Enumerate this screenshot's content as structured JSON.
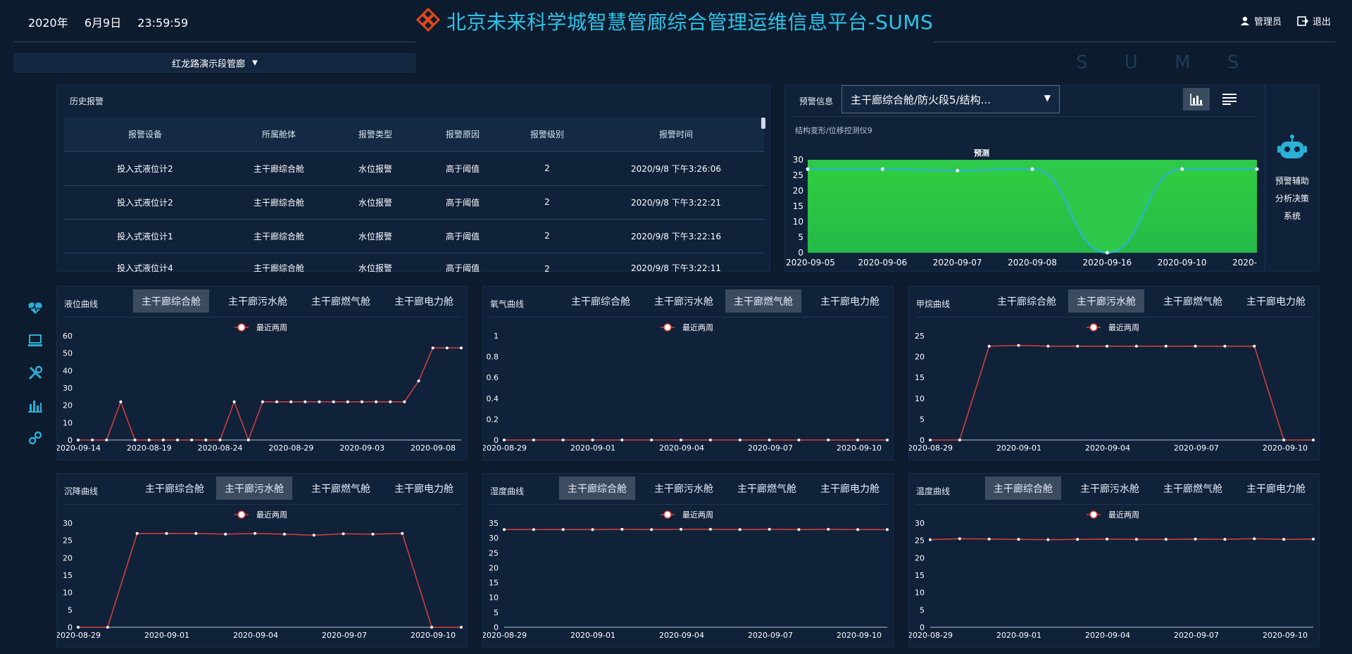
{
  "header": {
    "date_year": "2020年",
    "date_md": "6月9日",
    "time": "23:59:59",
    "title": "北京未来科学城智慧管廊综合管理运维信息平台-SUMS",
    "watermark": "SUMS",
    "user": "管理员",
    "logout": "退出",
    "accent_color": "#2dc3e8",
    "logo_color": "#e2471d"
  },
  "site_select": {
    "value": "红龙路演示段管廊"
  },
  "nav_icons": [
    "heartbeat-icon",
    "monitor-icon",
    "tools-icon",
    "bar-chart-icon",
    "gear-link-icon"
  ],
  "alarm": {
    "title": "历史报警",
    "columns": [
      "报警设备",
      "所属舱体",
      "报警类型",
      "报警原因",
      "报警级别",
      "报警时间"
    ],
    "rows": [
      [
        "投入式液位计2",
        "主干廊综合舱",
        "水位报警",
        "高于阈值",
        "2",
        "2020/9/8 下午3:26:06"
      ],
      [
        "投入式液位计2",
        "主干廊综合舱",
        "水位报警",
        "高于阈值",
        "2",
        "2020/9/8 下午3:22:21"
      ],
      [
        "投入式液位计1",
        "主干廊综合舱",
        "水位报警",
        "高于阈值",
        "2",
        "2020/9/8 下午3:22:16"
      ],
      [
        "投入式液位计4",
        "主干廊综合舱",
        "水位报警",
        "高于阈值",
        "2",
        "2020/9/8 下午3:22:11"
      ]
    ]
  },
  "warning": {
    "label": "预警信息",
    "select_value": "主干廊综合舱/防火段5/结构...",
    "ai_label_lines": [
      "预警辅助",
      "分析决策",
      "系统"
    ]
  },
  "tabs": [
    "主干廊综合舱",
    "主干廊污水舱",
    "主干廊燃气舱",
    "主干廊电力舱"
  ],
  "legend_label": "最近两周",
  "chart_data": [
    {
      "id": "warn",
      "type": "area",
      "title": "预测",
      "subtitle": "结构变形/位移控测仪9",
      "x": [
        "2020-09-05",
        "2020-09-06",
        "2020-09-07",
        "2020-09-08",
        "2020-09-16",
        "2020-09-10",
        "2020-"
      ],
      "values": [
        27,
        27,
        26.5,
        27,
        0,
        27,
        27
      ],
      "ylim": [
        0,
        30
      ],
      "yticks": [
        0,
        5,
        10,
        15,
        20,
        25,
        30
      ],
      "fill_color": "#2ec94a",
      "line_color": "#2bb5c9"
    },
    {
      "id": "level",
      "type": "line",
      "title": "液位曲线",
      "active_tab": 0,
      "series": [
        {
          "name": "最近两周",
          "values": [
            0,
            0,
            0,
            22,
            0,
            0,
            0,
            0,
            0,
            0,
            0,
            22,
            0,
            22,
            22,
            22,
            22,
            22,
            22,
            22,
            22,
            22,
            22,
            22,
            34,
            53,
            53,
            53
          ]
        }
      ],
      "x_labels": [
        "2020-09-14",
        "2020-08-19",
        "2020-08-24",
        "2020-08-29",
        "2020-09-03",
        "2020-09-08"
      ],
      "ylim": [
        0,
        60
      ],
      "yticks": [
        0,
        10,
        20,
        30,
        40,
        50,
        60
      ]
    },
    {
      "id": "oxygen",
      "type": "line",
      "title": "氧气曲线",
      "active_tab": 2,
      "series": [
        {
          "name": "最近两周",
          "values": [
            0,
            0,
            0,
            0,
            0,
            0,
            0,
            0,
            0,
            0,
            0,
            0,
            0,
            0
          ]
        }
      ],
      "x_labels": [
        "2020-08-29",
        "2020-09-01",
        "2020-09-04",
        "2020-09-07",
        "2020-09-10"
      ],
      "ylim": [
        0,
        1
      ],
      "yticks": [
        0,
        0.2,
        0.4,
        0.6,
        0.8,
        1
      ]
    },
    {
      "id": "methane",
      "type": "line",
      "title": "甲烷曲线",
      "active_tab": 1,
      "series": [
        {
          "name": "最近两周",
          "values": [
            0,
            0,
            22.5,
            22.7,
            22.5,
            22.5,
            22.5,
            22.5,
            22.5,
            22.5,
            22.5,
            22.5,
            0,
            0
          ]
        }
      ],
      "x_labels": [
        "2020-08-29",
        "2020-09-01",
        "2020-09-04",
        "2020-09-07",
        "2020-09-10"
      ],
      "ylim": [
        0,
        25
      ],
      "yticks": [
        0,
        5,
        10,
        15,
        20,
        25
      ]
    },
    {
      "id": "settle",
      "type": "line",
      "title": "沉降曲线",
      "active_tab": 1,
      "series": [
        {
          "name": "最近两周",
          "values": [
            0,
            0,
            27,
            27,
            27,
            26.8,
            27,
            26.8,
            26.5,
            26.9,
            26.8,
            27,
            0,
            0
          ]
        }
      ],
      "x_labels": [
        "2020-08-29",
        "2020-09-01",
        "2020-09-04",
        "2020-09-07",
        "2020-09-10"
      ],
      "ylim": [
        0,
        30
      ],
      "yticks": [
        0,
        5,
        10,
        15,
        20,
        25,
        30
      ]
    },
    {
      "id": "humidity",
      "type": "line",
      "title": "湿度曲线",
      "active_tab": 0,
      "series": [
        {
          "name": "最近两周",
          "values": [
            32.8,
            32.8,
            32.8,
            32.8,
            32.9,
            32.8,
            32.9,
            32.9,
            32.8,
            32.9,
            32.8,
            32.9,
            32.8,
            32.8
          ]
        }
      ],
      "x_labels": [
        "2020-08-29",
        "2020-09-01",
        "2020-09-04",
        "2020-09-07",
        "2020-09-10"
      ],
      "ylim": [
        0,
        35
      ],
      "yticks": [
        0,
        5,
        10,
        15,
        20,
        25,
        30,
        35
      ]
    },
    {
      "id": "temp",
      "type": "line",
      "title": "温度曲线",
      "active_tab": 0,
      "series": [
        {
          "name": "最近两周",
          "values": [
            25.2,
            25.5,
            25.4,
            25.3,
            25.2,
            25.3,
            25.4,
            25.3,
            25.3,
            25.4,
            25.3,
            25.5,
            25.3,
            25.4
          ]
        }
      ],
      "x_labels": [
        "2020-08-29",
        "2020-09-01",
        "2020-09-04",
        "2020-09-07",
        "2020-09-10"
      ],
      "ylim": [
        0,
        30
      ],
      "yticks": [
        0,
        5,
        10,
        15,
        20,
        25,
        30
      ]
    }
  ]
}
